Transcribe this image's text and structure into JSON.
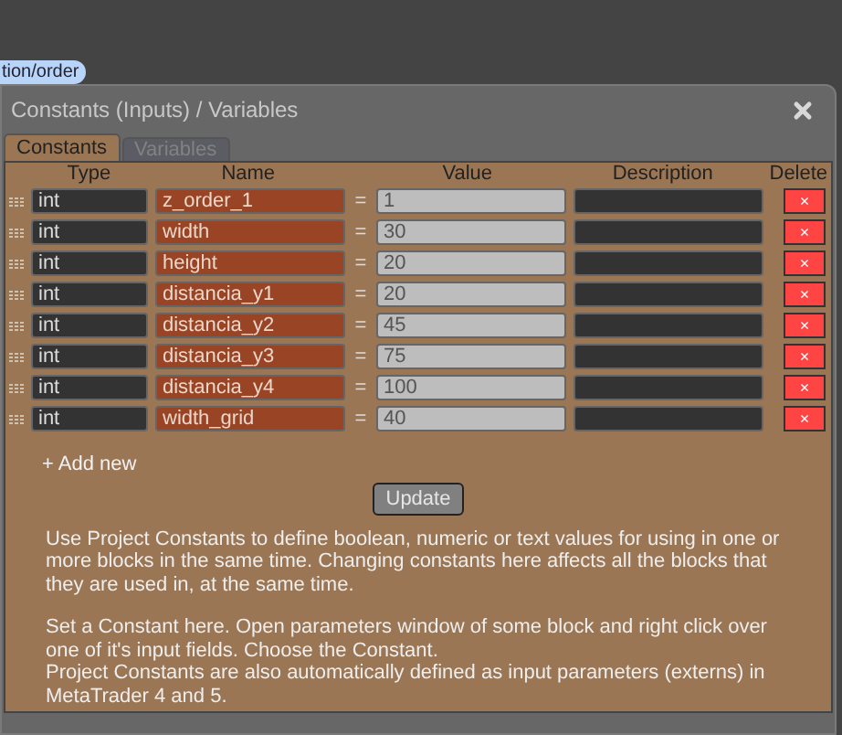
{
  "tag": "tion/order",
  "dialog": {
    "title": "Constants (Inputs) / Variables",
    "tabs": [
      {
        "label": "Constants",
        "selected": true
      },
      {
        "label": "Variables",
        "selected": false
      }
    ],
    "table": {
      "columns": [
        "Type",
        "Name",
        "Value",
        "Description",
        "Delete"
      ],
      "rows": [
        {
          "type": "int",
          "name": "z_order_1",
          "equals": "=",
          "value": "1",
          "delete": "×"
        },
        {
          "type": "int",
          "name": "width",
          "equals": "=",
          "value": "30",
          "delete": "×"
        },
        {
          "type": "int",
          "name": "height",
          "equals": "=",
          "value": "20",
          "delete": "×"
        },
        {
          "type": "int",
          "name": "distancia_y1",
          "equals": "=",
          "value": "20",
          "delete": "×"
        },
        {
          "type": "int",
          "name": "distancia_y2",
          "equals": "=",
          "value": "45",
          "delete": "×"
        },
        {
          "type": "int",
          "name": "distancia_y3",
          "equals": "=",
          "value": "75",
          "delete": "×"
        },
        {
          "type": "int",
          "name": "distancia_y4",
          "equals": "=",
          "value": "100",
          "delete": "×"
        },
        {
          "type": "int",
          "name": "width_grid",
          "equals": "=",
          "value": "40",
          "delete": "×"
        }
      ]
    },
    "add_new": "+ Add new",
    "update_button": "Update",
    "help": [
      "Use Project Constants to define boolean, numeric or text values for using in one or more blocks in the same time. Changing constants here affects all the blocks that they are used in, at the same time.",
      "Set a Constant here. Open parameters window of some block and right click over one of it's input fields. Choose the Constant.\nProject Constants are also automatically defined as input parameters (externs) in MetaTrader 4 and 5."
    ]
  }
}
